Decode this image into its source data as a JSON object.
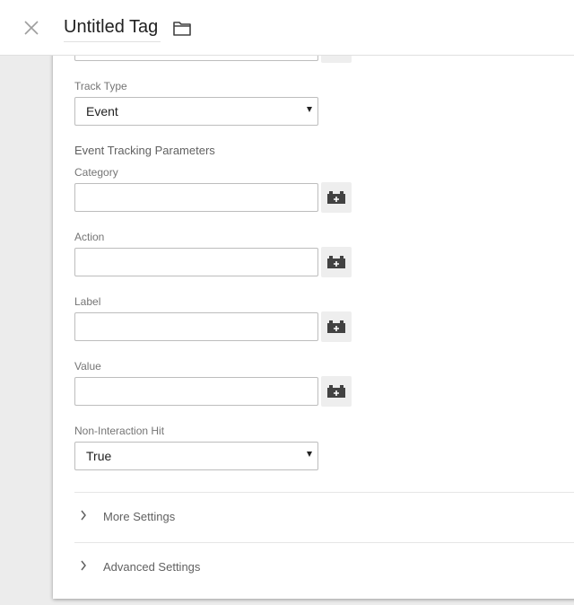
{
  "header": {
    "title": "Untitled Tag",
    "close_icon": "close-icon",
    "folder_icon": "folder-icon"
  },
  "form": {
    "track_type": {
      "label": "Track Type",
      "value": "Event"
    },
    "event_section_title": "Event Tracking Parameters",
    "fields": [
      {
        "label": "Category",
        "value": ""
      },
      {
        "label": "Action",
        "value": ""
      },
      {
        "label": "Label",
        "value": ""
      },
      {
        "label": "Value",
        "value": ""
      }
    ],
    "variable_icon": "variable-picker-icon",
    "non_interaction": {
      "label": "Non-Interaction Hit",
      "value": "True"
    }
  },
  "sections": {
    "more_settings": "More Settings",
    "advanced_settings": "Advanced Settings"
  },
  "colors": {
    "background": "#ececec",
    "panel": "#ffffff",
    "border": "#bdbdbd",
    "icon": "#424242"
  }
}
